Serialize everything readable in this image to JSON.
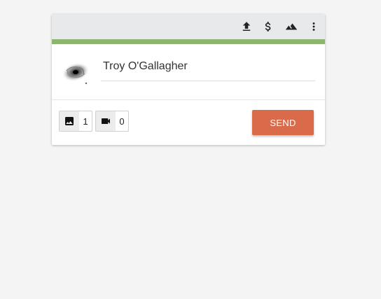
{
  "colors": {
    "accent_bar": "#8db56f",
    "send_button": "#d96a4a",
    "toolbar_bg": "#e8e9ea",
    "icon": "#222222"
  },
  "toolbar": {
    "icons": [
      "upload-icon",
      "dollar-icon",
      "landscape-icon",
      "more-vert-icon"
    ]
  },
  "profile": {
    "avatar_icon": "avatar-galaxy",
    "name": "Troy O'Gallagher"
  },
  "footer": {
    "image_count": "1",
    "video_count": "0",
    "image_icon": "image-icon",
    "video_icon": "videocam-icon",
    "send_label": "SEND"
  }
}
